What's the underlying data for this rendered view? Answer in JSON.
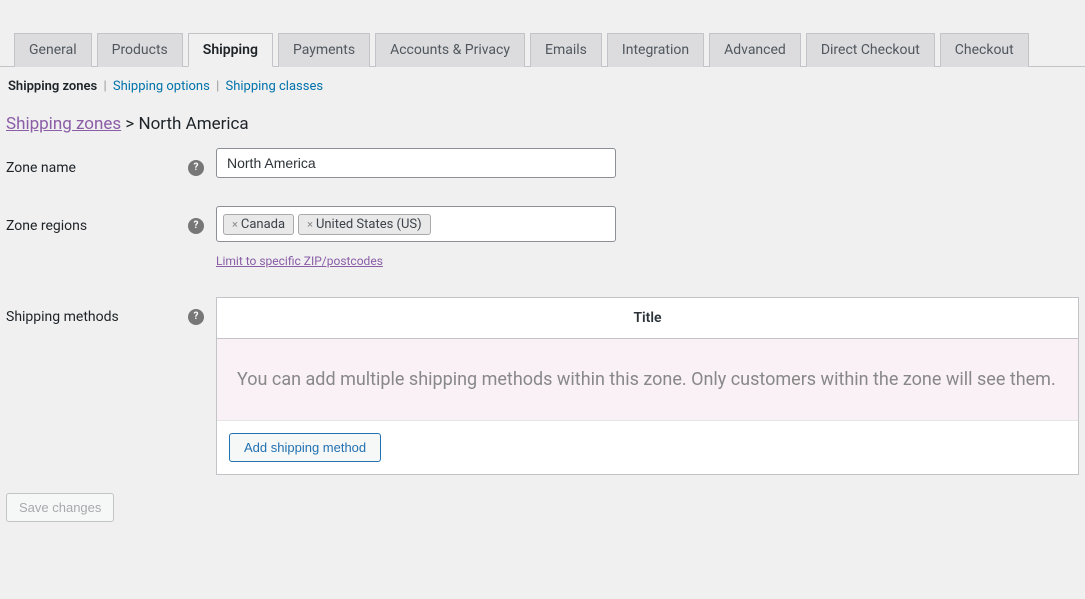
{
  "tabs": [
    {
      "label": "General"
    },
    {
      "label": "Products"
    },
    {
      "label": "Shipping",
      "active": true
    },
    {
      "label": "Payments"
    },
    {
      "label": "Accounts & Privacy"
    },
    {
      "label": "Emails"
    },
    {
      "label": "Integration"
    },
    {
      "label": "Advanced"
    },
    {
      "label": "Direct Checkout"
    },
    {
      "label": "Checkout"
    }
  ],
  "subtabs": {
    "current": "Shipping zones",
    "options": "Shipping options",
    "classes": "Shipping classes"
  },
  "breadcrumb": {
    "parent": "Shipping zones",
    "current": "North America"
  },
  "form": {
    "zone_name_label": "Zone name",
    "zone_name_value": "North America",
    "zone_regions_label": "Zone regions",
    "zone_regions_tags": [
      "Canada",
      "United States (US)"
    ],
    "zip_link": "Limit to specific ZIP/postcodes",
    "shipping_methods_label": "Shipping methods"
  },
  "methods": {
    "title_header": "Title",
    "empty_message": "You can add multiple shipping methods within this zone. Only customers within the zone will see them.",
    "add_button": "Add shipping method"
  },
  "save_button": "Save changes",
  "help_glyph": "?"
}
